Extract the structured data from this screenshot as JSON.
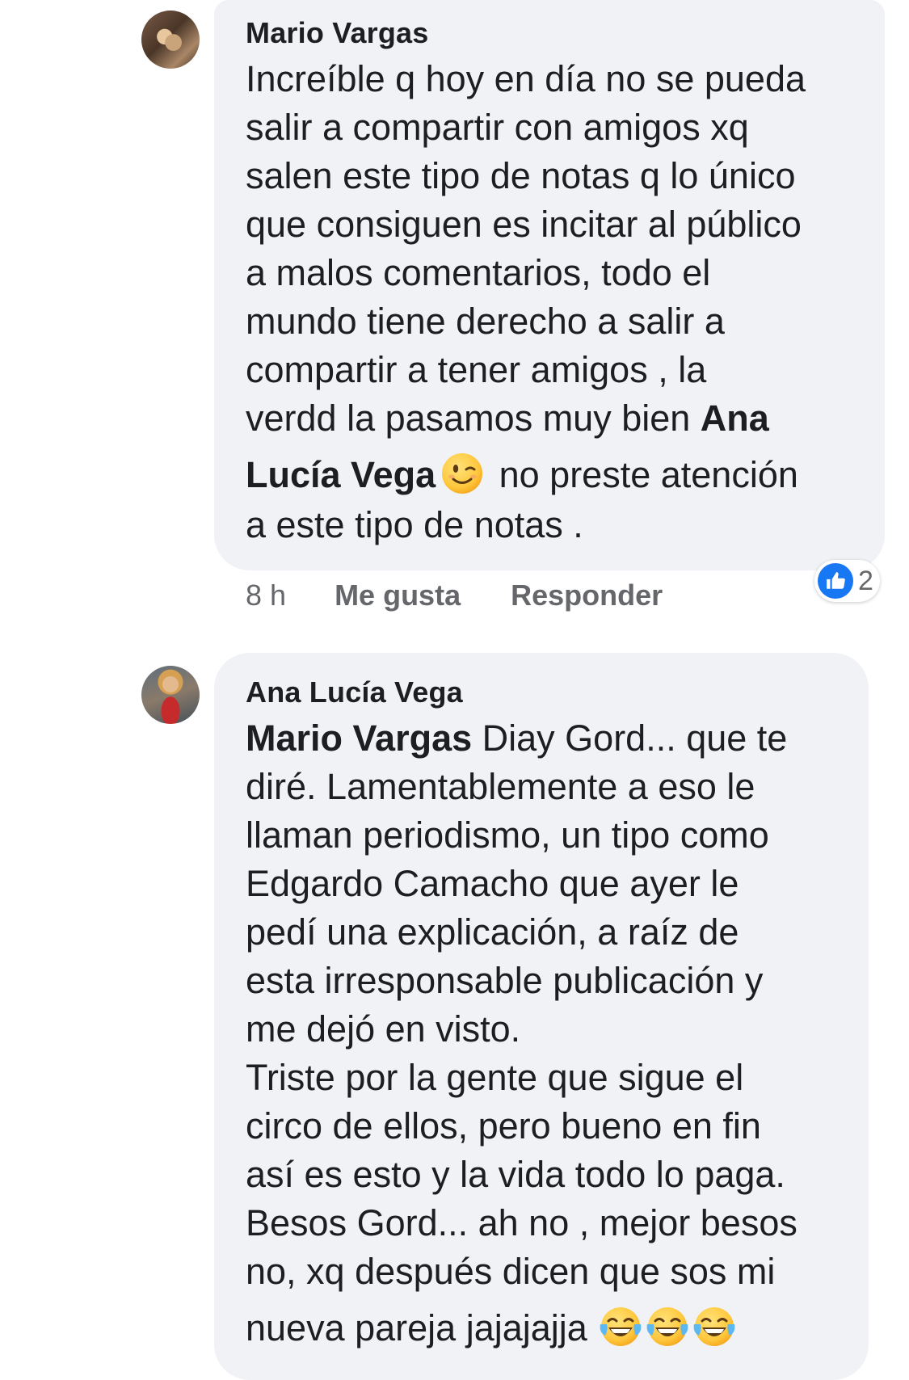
{
  "comments": [
    {
      "author": "Mario Vargas",
      "lines": [
        "Increíble q hoy en día no se pueda",
        "salir a compartir con amigos xq",
        "salen este tipo de notas q lo único",
        "que consiguen es incitar al público",
        "a malos comentarios, todo el",
        "mundo tiene derecho a salir a",
        "compartir a tener amigos , la",
        "verdd la pasamos muy bien "
      ],
      "mention_part1": "Ana",
      "mention_part2": "Lucía Vega",
      "after_emoji": " no preste atención",
      "last_line": "a este tipo de notas .",
      "emoji_icon": "winking-face-icon",
      "time": "8 h",
      "like_label": "Me gusta",
      "reply_label": "Responder",
      "reaction_icon": "thumbs-up-icon",
      "reaction_count": "2"
    },
    {
      "author": "Ana Lucía Vega",
      "mention": "Mario Vargas",
      "first_line_rest": " Diay Gord... que te",
      "lines": [
        "diré. Lamentablemente a eso le",
        "llaman periodismo, un tipo como",
        "Edgardo Camacho que ayer le",
        "pedí una explicación, a raíz de",
        "esta irresponsable publicación y",
        "me dejó en visto.",
        "Triste por la gente que sigue el",
        "circo de ellos, pero bueno en fin",
        "así es esto y la vida todo lo paga.",
        "Besos Gord... ah no , mejor besos",
        "no, xq después dicen que sos mi"
      ],
      "last_line": "nueva pareja jajajajja ",
      "emoji_icon": "face-with-tears-of-joy-icon"
    }
  ],
  "colors": {
    "bubble": "#f0f2f5",
    "text": "#1c1e21",
    "secondary": "#65676b",
    "like_blue": "#1877f2"
  }
}
